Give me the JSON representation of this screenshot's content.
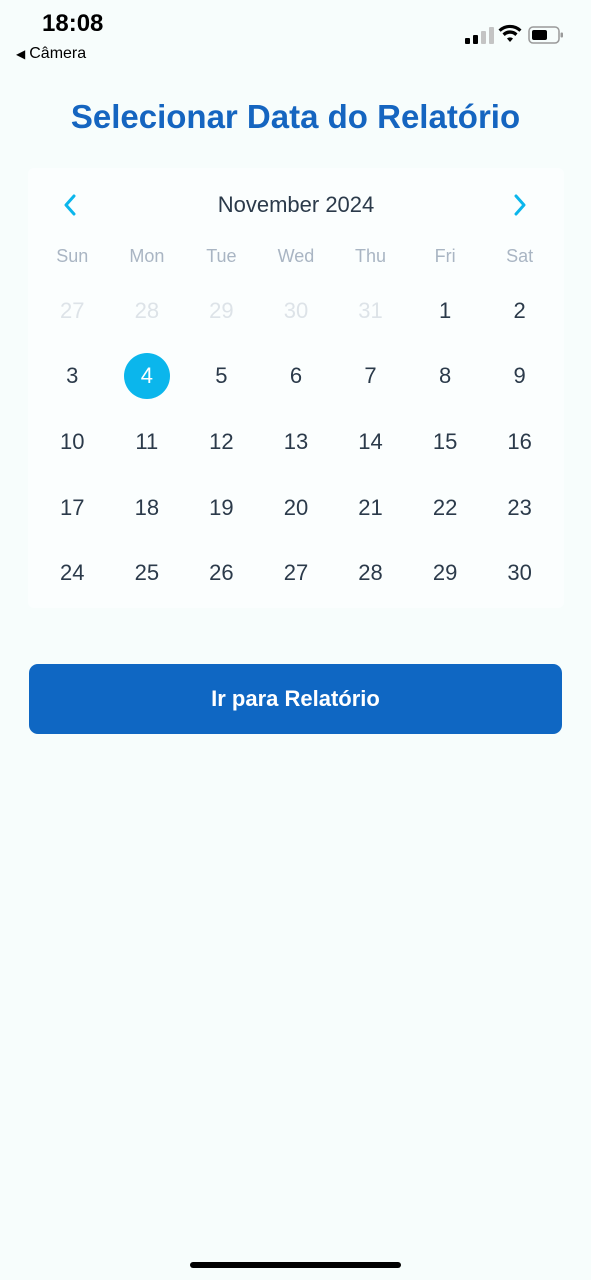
{
  "status_bar": {
    "time": "18:08",
    "back_label": "Câmera"
  },
  "title": "Selecionar Data do Relatório",
  "calendar": {
    "month_label": "November 2024",
    "weekdays": [
      "Sun",
      "Mon",
      "Tue",
      "Wed",
      "Thu",
      "Fri",
      "Sat"
    ],
    "weeks": [
      [
        {
          "d": "27",
          "muted": true
        },
        {
          "d": "28",
          "muted": true
        },
        {
          "d": "29",
          "muted": true
        },
        {
          "d": "30",
          "muted": true
        },
        {
          "d": "31",
          "muted": true
        },
        {
          "d": "1"
        },
        {
          "d": "2"
        }
      ],
      [
        {
          "d": "3"
        },
        {
          "d": "4",
          "selected": true
        },
        {
          "d": "5"
        },
        {
          "d": "6"
        },
        {
          "d": "7"
        },
        {
          "d": "8"
        },
        {
          "d": "9"
        }
      ],
      [
        {
          "d": "10"
        },
        {
          "d": "11"
        },
        {
          "d": "12"
        },
        {
          "d": "13"
        },
        {
          "d": "14"
        },
        {
          "d": "15"
        },
        {
          "d": "16"
        }
      ],
      [
        {
          "d": "17"
        },
        {
          "d": "18"
        },
        {
          "d": "19"
        },
        {
          "d": "20"
        },
        {
          "d": "21"
        },
        {
          "d": "22"
        },
        {
          "d": "23"
        }
      ],
      [
        {
          "d": "24"
        },
        {
          "d": "25"
        },
        {
          "d": "26"
        },
        {
          "d": "27"
        },
        {
          "d": "28"
        },
        {
          "d": "29"
        },
        {
          "d": "30"
        }
      ]
    ],
    "prev_icon": "chevron-left-icon",
    "next_icon": "chevron-right-icon"
  },
  "button_label": "Ir para Relatório",
  "colors": {
    "title": "#1565c0",
    "accent": "#0bb6ec",
    "button": "#0f67c3",
    "background": "#f7fdfc"
  }
}
